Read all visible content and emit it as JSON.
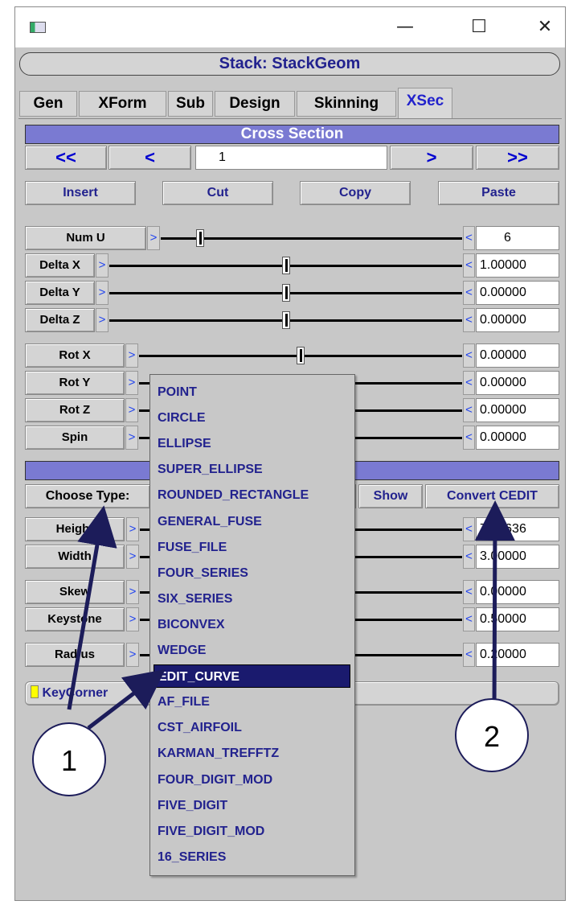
{
  "window": {
    "minimize": "—",
    "maximize": "☐",
    "close": "✕",
    "colors": {
      "accent_bar": "#7a7ad2",
      "selected": "#1a1a6e",
      "link_text": "#22228e",
      "nav_arrows": "#0000d0"
    }
  },
  "title": "Stack: StackGeom",
  "tabs": [
    "Gen",
    "XForm",
    "Sub",
    "Design",
    "Skinning",
    "XSec"
  ],
  "active_tab": "XSec",
  "cross_section": {
    "header": "Cross Section",
    "nav": {
      "first": "<<",
      "prev": "<",
      "index": "1",
      "next": ">",
      "last": ">>"
    },
    "actions": {
      "insert": "Insert",
      "cut": "Cut",
      "copy": "Copy",
      "paste": "Paste"
    }
  },
  "sliders": [
    {
      "label": "Num U",
      "value": "6",
      "pos": 0.13
    },
    {
      "label": "Delta X",
      "value": "1.00000",
      "pos": 0.5
    },
    {
      "label": "Delta Y",
      "value": "0.00000",
      "pos": 0.5
    },
    {
      "label": "Delta Z",
      "value": "0.00000",
      "pos": 0.5
    },
    {
      "label": "Rot X",
      "value": "0.00000",
      "pos": 0.5
    },
    {
      "label": "Rot Y",
      "value": "0.00000",
      "pos": 0.5
    },
    {
      "label": "Rot Z",
      "value": "0.00000",
      "pos": 0.5
    },
    {
      "label": "Spin",
      "value": "0.00000",
      "pos": 0.5
    }
  ],
  "shape": {
    "choose_type": "Choose Type:",
    "show": "Show",
    "convert": "Convert CEDIT",
    "params": [
      {
        "label": "Height",
        "value": "7.38636"
      },
      {
        "label": "Width",
        "value": "3.00000"
      },
      {
        "label": "Skew",
        "value": "0.00000"
      },
      {
        "label": "Keystone",
        "value": "0.50000"
      },
      {
        "label": "Radius",
        "value": "0.20000"
      }
    ],
    "key_corner": "KeyCorner"
  },
  "dropdown": {
    "options": [
      "POINT",
      "CIRCLE",
      "ELLIPSE",
      "SUPER_ELLIPSE",
      "ROUNDED_RECTANGLE",
      "GENERAL_FUSE",
      "FUSE_FILE",
      "FOUR_SERIES",
      "SIX_SERIES",
      "BICONVEX",
      "WEDGE",
      "EDIT_CURVE",
      "AF_FILE",
      "CST_AIRFOIL",
      "KARMAN_TREFFTZ",
      "FOUR_DIGIT_MOD",
      "FIVE_DIGIT",
      "FIVE_DIGIT_MOD",
      "16_SERIES"
    ],
    "selected": "EDIT_CURVE"
  },
  "callouts": [
    "1",
    "2"
  ]
}
